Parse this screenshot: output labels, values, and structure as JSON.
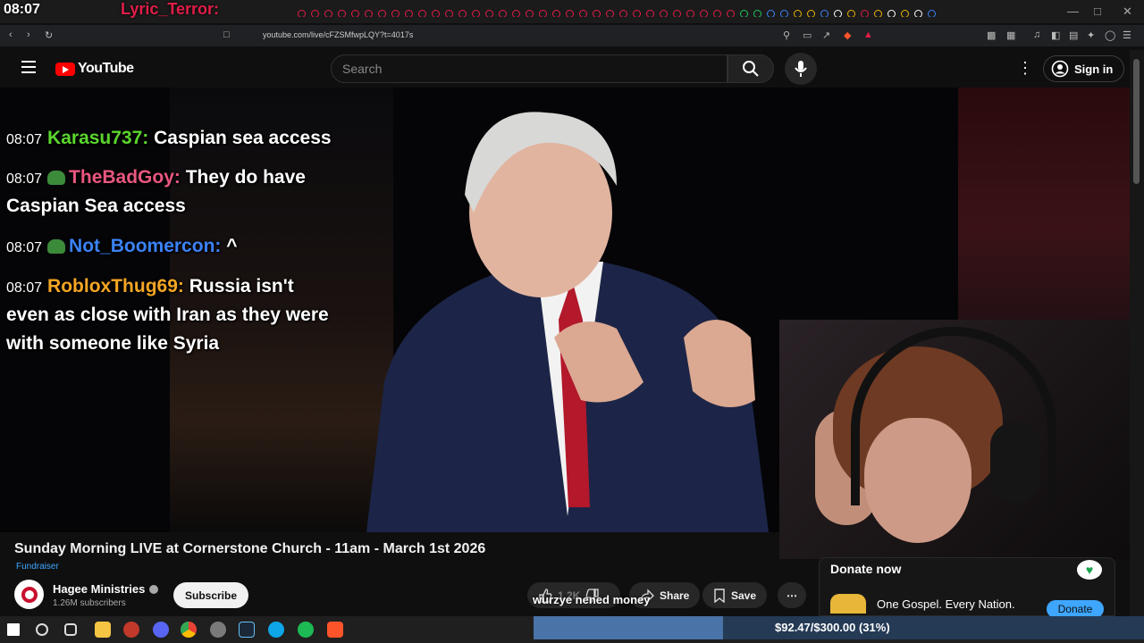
{
  "stream_overlay": {
    "clock": "08:07",
    "now_playing": "Lyric_Terror:"
  },
  "browser": {
    "url": "youtube.com/live/cFZSMfwpLQY?t=4017s"
  },
  "youtube": {
    "logo_text": "YouTube",
    "search_placeholder": "Search",
    "sign_in": "Sign in"
  },
  "chat": [
    {
      "time": "08:07",
      "user": "Karasu737",
      "color": "#5bd62e",
      "message": "Caspian sea access",
      "badge": false
    },
    {
      "time": "08:07",
      "user": "TheBadGoy",
      "color": "#e9577f",
      "message": "They do have",
      "message_cont": "Caspian Sea access",
      "badge": true
    },
    {
      "time": "08:07",
      "user": "Not_Boomercon",
      "color": "#3b82f6",
      "message": "^",
      "badge": true
    },
    {
      "time": "08:07",
      "user": "RobloxThug69",
      "color": "#f5a623",
      "message": "Russia isn't",
      "message_cont": "even as close with Iran as they were",
      "message_cont2": "with someone like Syria",
      "badge": false
    }
  ],
  "video": {
    "title": "Sunday Morning LIVE at Cornerstone Church - 11am - March 1st 2026",
    "tag": "Fundraiser",
    "channel": "Hagee Ministries",
    "subscribers": "1.26M subscribers",
    "subscribe": "Subscribe",
    "likes": "1.2K",
    "share": "Share",
    "save": "Save",
    "overlay_caption": "wurzye nened money"
  },
  "donate": {
    "title": "Donate now",
    "org": "One Gospel. Every Nation.",
    "button": "Donate"
  },
  "goal": {
    "text": "$92.47/$300.00 (31%)",
    "fraction": 0.31
  }
}
